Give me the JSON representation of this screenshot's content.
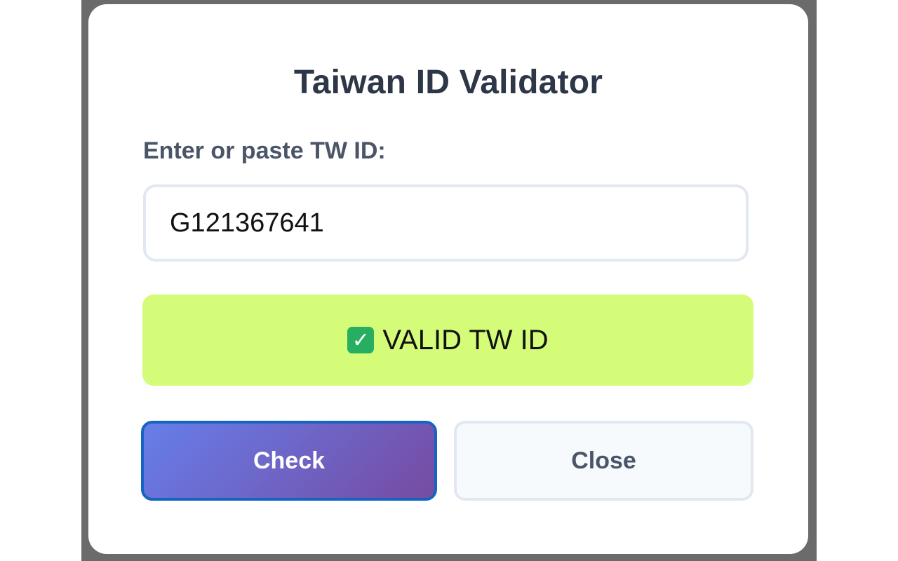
{
  "dialog": {
    "title": "Taiwan ID Validator",
    "input_label": "Enter or paste TW ID:",
    "input_value": "G121367641",
    "result_text": "VALID TW ID",
    "result_icon": "check-mark-icon",
    "check_label": "Check",
    "close_label": "Close"
  },
  "colors": {
    "title": "#2d3748",
    "label": "#4a5568",
    "result_bg": "#d4fc79",
    "check_gradient_start": "#667eea",
    "check_gradient_end": "#764ba2",
    "check_border": "#1565c0",
    "close_bg": "#f7fafc",
    "close_text": "#4a5568",
    "backdrop": "#6b6b6b"
  }
}
